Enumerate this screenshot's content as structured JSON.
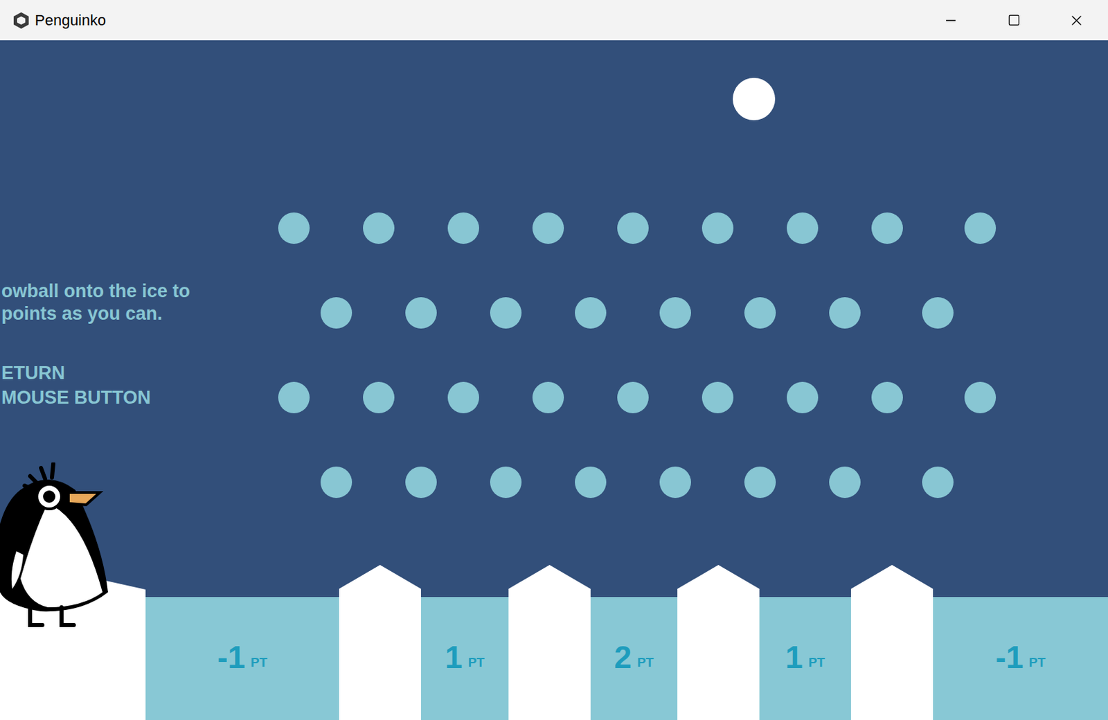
{
  "window": {
    "title": "Penguinko"
  },
  "instructions": {
    "lines": [
      "owball onto the ice to",
      "points as you can."
    ],
    "controls": [
      "ETURN",
      "MOUSE BUTTON"
    ]
  },
  "ball": {
    "shown": true
  },
  "peg_rows": [
    9,
    8,
    9,
    8
  ],
  "buckets": [
    {
      "value": "-1",
      "unit": "PT"
    },
    {
      "value": "1",
      "unit": "PT"
    },
    {
      "value": "2",
      "unit": "PT"
    },
    {
      "value": "1",
      "unit": "PT"
    },
    {
      "value": "-1",
      "unit": "PT"
    }
  ]
}
